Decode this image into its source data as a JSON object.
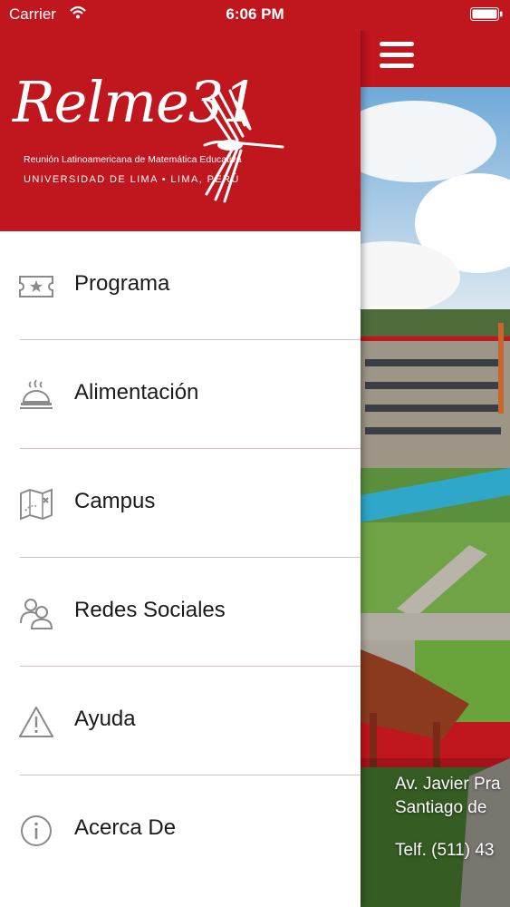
{
  "status_bar": {
    "carrier": "Carrier",
    "time": "6:06 PM"
  },
  "logo": {
    "title": "Relme31",
    "subtitle_1": "Reunión Latinoamericana de Matemática Educativa",
    "subtitle_2": "UNIVERSIDAD DE LIMA • LIMA, PERÚ"
  },
  "menu": {
    "items": [
      {
        "label": "Programa",
        "icon": "ticket-icon"
      },
      {
        "label": "Alimentación",
        "icon": "food-tray-icon"
      },
      {
        "label": "Campus",
        "icon": "map-icon"
      },
      {
        "label": "Redes Sociales",
        "icon": "users-icon"
      },
      {
        "label": "Ayuda",
        "icon": "warning-icon"
      },
      {
        "label": "Acerca De",
        "icon": "info-icon"
      }
    ]
  },
  "background": {
    "address_line_1": "Av. Javier Pra",
    "address_line_2": "Santiago de",
    "phone": "Telf. (511) 43"
  },
  "colors": {
    "brand": "#c0161d",
    "divider": "#e5bcbc",
    "icon": "#8a8a8a"
  }
}
